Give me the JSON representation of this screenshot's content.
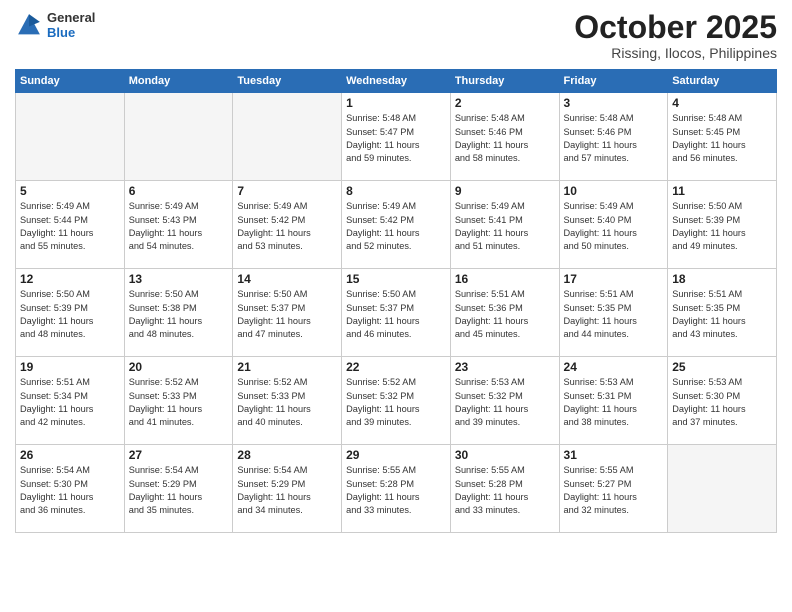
{
  "header": {
    "logo_general": "General",
    "logo_blue": "Blue",
    "month_title": "October 2025",
    "location": "Rissing, Ilocos, Philippines"
  },
  "weekdays": [
    "Sunday",
    "Monday",
    "Tuesday",
    "Wednesday",
    "Thursday",
    "Friday",
    "Saturday"
  ],
  "weeks": [
    [
      {
        "day": "",
        "info": ""
      },
      {
        "day": "",
        "info": ""
      },
      {
        "day": "",
        "info": ""
      },
      {
        "day": "1",
        "info": "Sunrise: 5:48 AM\nSunset: 5:47 PM\nDaylight: 11 hours\nand 59 minutes."
      },
      {
        "day": "2",
        "info": "Sunrise: 5:48 AM\nSunset: 5:46 PM\nDaylight: 11 hours\nand 58 minutes."
      },
      {
        "day": "3",
        "info": "Sunrise: 5:48 AM\nSunset: 5:46 PM\nDaylight: 11 hours\nand 57 minutes."
      },
      {
        "day": "4",
        "info": "Sunrise: 5:48 AM\nSunset: 5:45 PM\nDaylight: 11 hours\nand 56 minutes."
      }
    ],
    [
      {
        "day": "5",
        "info": "Sunrise: 5:49 AM\nSunset: 5:44 PM\nDaylight: 11 hours\nand 55 minutes."
      },
      {
        "day": "6",
        "info": "Sunrise: 5:49 AM\nSunset: 5:43 PM\nDaylight: 11 hours\nand 54 minutes."
      },
      {
        "day": "7",
        "info": "Sunrise: 5:49 AM\nSunset: 5:42 PM\nDaylight: 11 hours\nand 53 minutes."
      },
      {
        "day": "8",
        "info": "Sunrise: 5:49 AM\nSunset: 5:42 PM\nDaylight: 11 hours\nand 52 minutes."
      },
      {
        "day": "9",
        "info": "Sunrise: 5:49 AM\nSunset: 5:41 PM\nDaylight: 11 hours\nand 51 minutes."
      },
      {
        "day": "10",
        "info": "Sunrise: 5:49 AM\nSunset: 5:40 PM\nDaylight: 11 hours\nand 50 minutes."
      },
      {
        "day": "11",
        "info": "Sunrise: 5:50 AM\nSunset: 5:39 PM\nDaylight: 11 hours\nand 49 minutes."
      }
    ],
    [
      {
        "day": "12",
        "info": "Sunrise: 5:50 AM\nSunset: 5:39 PM\nDaylight: 11 hours\nand 48 minutes."
      },
      {
        "day": "13",
        "info": "Sunrise: 5:50 AM\nSunset: 5:38 PM\nDaylight: 11 hours\nand 48 minutes."
      },
      {
        "day": "14",
        "info": "Sunrise: 5:50 AM\nSunset: 5:37 PM\nDaylight: 11 hours\nand 47 minutes."
      },
      {
        "day": "15",
        "info": "Sunrise: 5:50 AM\nSunset: 5:37 PM\nDaylight: 11 hours\nand 46 minutes."
      },
      {
        "day": "16",
        "info": "Sunrise: 5:51 AM\nSunset: 5:36 PM\nDaylight: 11 hours\nand 45 minutes."
      },
      {
        "day": "17",
        "info": "Sunrise: 5:51 AM\nSunset: 5:35 PM\nDaylight: 11 hours\nand 44 minutes."
      },
      {
        "day": "18",
        "info": "Sunrise: 5:51 AM\nSunset: 5:35 PM\nDaylight: 11 hours\nand 43 minutes."
      }
    ],
    [
      {
        "day": "19",
        "info": "Sunrise: 5:51 AM\nSunset: 5:34 PM\nDaylight: 11 hours\nand 42 minutes."
      },
      {
        "day": "20",
        "info": "Sunrise: 5:52 AM\nSunset: 5:33 PM\nDaylight: 11 hours\nand 41 minutes."
      },
      {
        "day": "21",
        "info": "Sunrise: 5:52 AM\nSunset: 5:33 PM\nDaylight: 11 hours\nand 40 minutes."
      },
      {
        "day": "22",
        "info": "Sunrise: 5:52 AM\nSunset: 5:32 PM\nDaylight: 11 hours\nand 39 minutes."
      },
      {
        "day": "23",
        "info": "Sunrise: 5:53 AM\nSunset: 5:32 PM\nDaylight: 11 hours\nand 39 minutes."
      },
      {
        "day": "24",
        "info": "Sunrise: 5:53 AM\nSunset: 5:31 PM\nDaylight: 11 hours\nand 38 minutes."
      },
      {
        "day": "25",
        "info": "Sunrise: 5:53 AM\nSunset: 5:30 PM\nDaylight: 11 hours\nand 37 minutes."
      }
    ],
    [
      {
        "day": "26",
        "info": "Sunrise: 5:54 AM\nSunset: 5:30 PM\nDaylight: 11 hours\nand 36 minutes."
      },
      {
        "day": "27",
        "info": "Sunrise: 5:54 AM\nSunset: 5:29 PM\nDaylight: 11 hours\nand 35 minutes."
      },
      {
        "day": "28",
        "info": "Sunrise: 5:54 AM\nSunset: 5:29 PM\nDaylight: 11 hours\nand 34 minutes."
      },
      {
        "day": "29",
        "info": "Sunrise: 5:55 AM\nSunset: 5:28 PM\nDaylight: 11 hours\nand 33 minutes."
      },
      {
        "day": "30",
        "info": "Sunrise: 5:55 AM\nSunset: 5:28 PM\nDaylight: 11 hours\nand 33 minutes."
      },
      {
        "day": "31",
        "info": "Sunrise: 5:55 AM\nSunset: 5:27 PM\nDaylight: 11 hours\nand 32 minutes."
      },
      {
        "day": "",
        "info": ""
      }
    ]
  ]
}
